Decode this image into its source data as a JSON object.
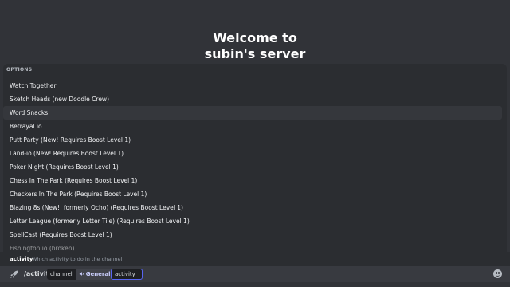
{
  "welcome": {
    "line1": "Welcome to",
    "line2": "subin's server"
  },
  "autocomplete": {
    "header": "OPTIONS",
    "options": [
      "Watch Together",
      "Sketch Heads (new Doodle Crew)",
      "Word Snacks",
      "Betrayal.io",
      "Putt Party (New! Requires Boost Level 1)",
      "Land-io (New! Requires Boost Level 1)",
      "Poker Night (Requires Boost Level 1)",
      "Chess In The Park (Requires Boost Level 1)",
      "Checkers In The Park (Requires Boost Level 1)",
      "Blazing 8s (New!, formerly Ocho) (Requires Boost Level 1)",
      "Letter League (formerly Letter Tile) (Requires Boost Level 1)",
      "SpellCast (Requires Boost Level 1)",
      "Fishington.io (broken)"
    ],
    "highlighted_index": 2
  },
  "arg_hint": {
    "name": "activity",
    "description": "Which activity to do in the channel"
  },
  "composer": {
    "command": "/activity",
    "channel_label": "channel",
    "channel_value": "General",
    "activity_label": "activity"
  },
  "icons": {
    "command_icon": "rocket-icon",
    "emoji_icon": "emoji-smile-icon",
    "voice_icon": "speaker-icon"
  },
  "colors": {
    "accent": "#5865f2",
    "background": "#313338",
    "panel": "#2b2d31"
  }
}
